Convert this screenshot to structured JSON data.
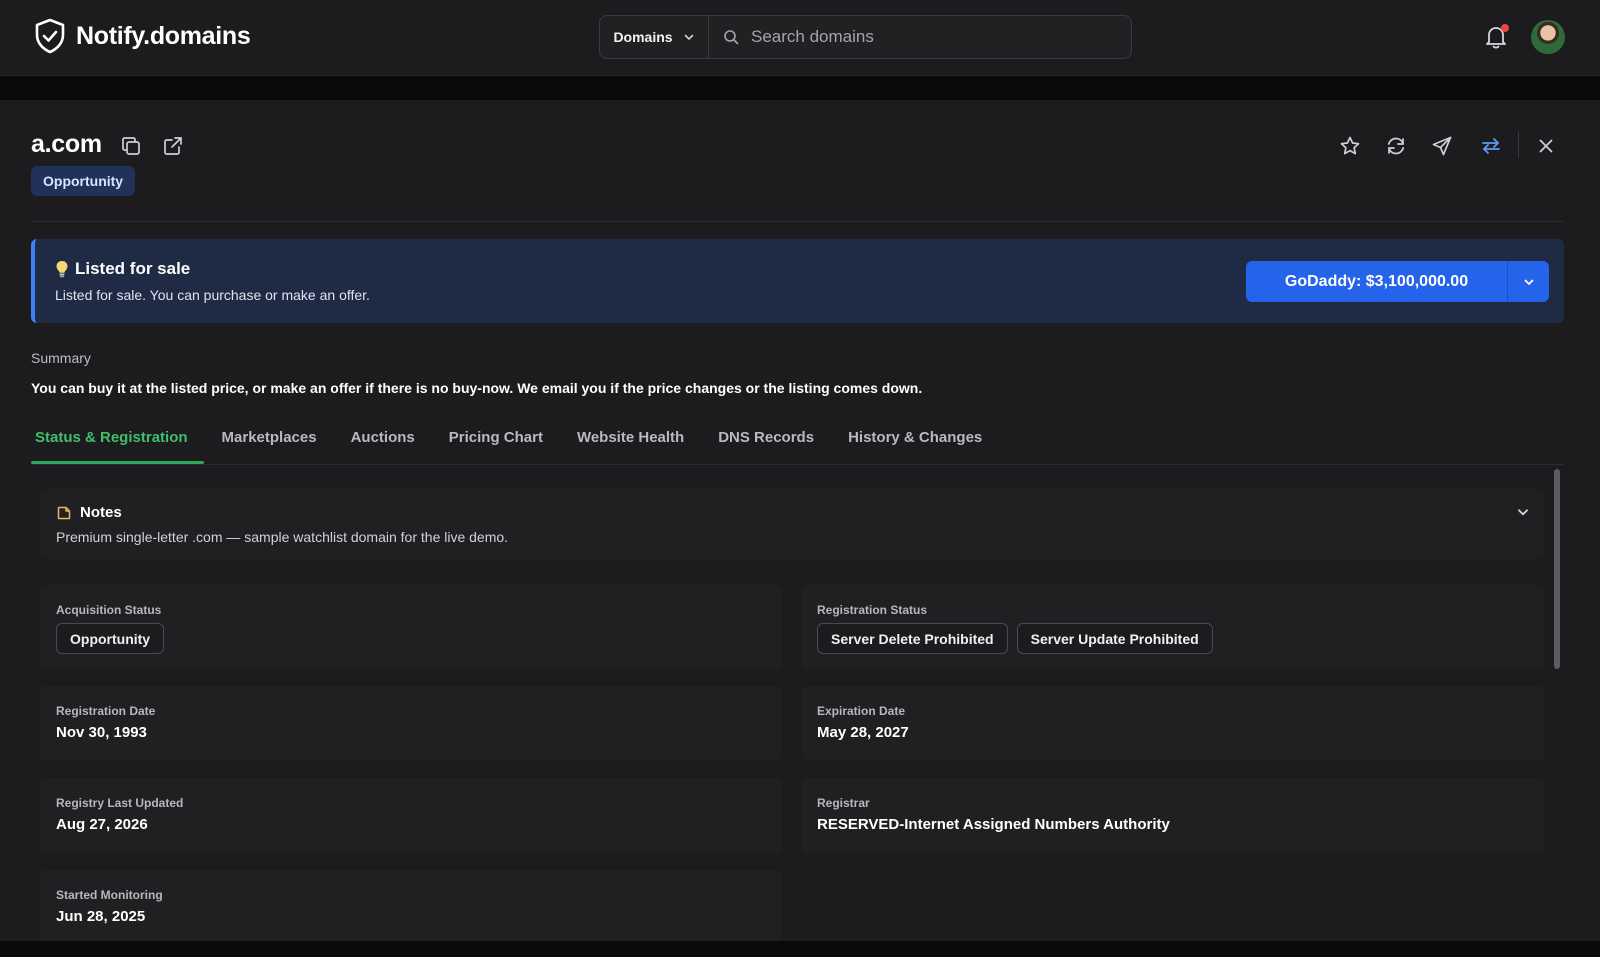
{
  "app": {
    "name": "Notify.domains"
  },
  "search": {
    "scope": "Domains",
    "placeholder": "Search domains"
  },
  "domain": {
    "name": "a.com",
    "tag": "Opportunity"
  },
  "banner": {
    "title": "Listed for sale",
    "subtitle": "Listed for sale. You can purchase or make an offer.",
    "buy_label": "GoDaddy: $3,100,000.00"
  },
  "summary": {
    "label": "Summary",
    "text": "You can buy it at the listed price, or make an offer if there is no buy-now. We email you if the price changes or the listing comes down."
  },
  "tabs": [
    {
      "label": "Status & Registration",
      "active": true
    },
    {
      "label": "Marketplaces"
    },
    {
      "label": "Auctions"
    },
    {
      "label": "Pricing Chart"
    },
    {
      "label": "Website Health"
    },
    {
      "label": "DNS Records"
    },
    {
      "label": "History & Changes"
    }
  ],
  "notes": {
    "title": "Notes",
    "text": "Premium single-letter .com — sample watchlist domain for the live demo."
  },
  "fields": {
    "acquisition_status": {
      "label": "Acquisition Status",
      "value": "Opportunity"
    },
    "registration_status": {
      "label": "Registration Status",
      "values": [
        "Server Delete Prohibited",
        "Server Update Prohibited"
      ]
    },
    "registration_date": {
      "label": "Registration Date",
      "value": "Nov 30, 1993"
    },
    "expiration_date": {
      "label": "Expiration Date",
      "value": "May 28, 2027"
    },
    "registry_last_updated": {
      "label": "Registry Last Updated",
      "value": "Aug 27, 2026"
    },
    "registrar": {
      "label": "Registrar",
      "value": "RESERVED-Internet Assigned Numbers Authority"
    },
    "started_monitoring": {
      "label": "Started Monitoring",
      "value": "Jun 28, 2025"
    }
  },
  "colors": {
    "accent_blue": "#2563eb",
    "tab_active": "#3fbf6b",
    "notification_dot": "#ef4444"
  },
  "icons": [
    "shield-check-icon",
    "chevron-down-icon",
    "search-icon",
    "bell-icon",
    "copy-icon",
    "external-link-icon",
    "star-icon",
    "refresh-icon",
    "send-icon",
    "sync-icon",
    "close-icon",
    "lightbulb-icon",
    "note-icon"
  ]
}
